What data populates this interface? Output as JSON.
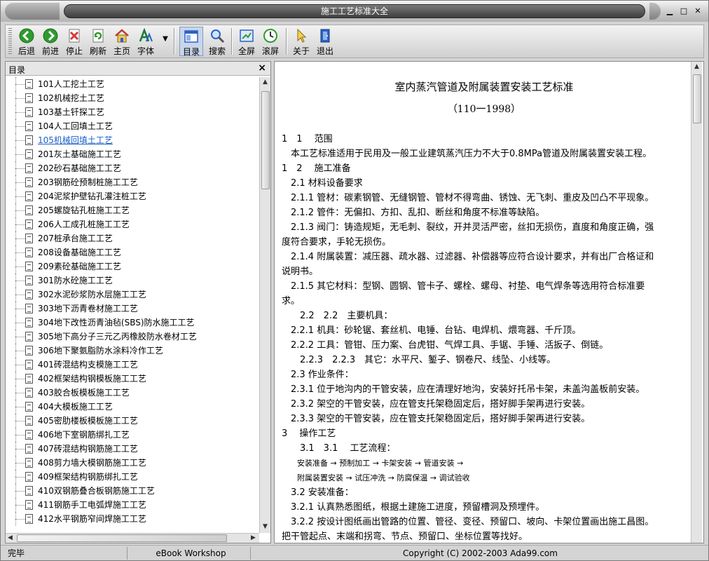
{
  "window": {
    "title": "施工工艺标准大全",
    "controls": {
      "minimize": "▁",
      "maximize": "□",
      "close": "✕"
    }
  },
  "toolbar": {
    "back": "后退",
    "forward": "前进",
    "stop": "停止",
    "refresh": "刷新",
    "home": "主页",
    "font": "字体",
    "contents": "目录",
    "search": "搜索",
    "fullscreen": "全屏",
    "scroll": "滚屏",
    "about": "关于",
    "exit": "退出",
    "colors": {
      "green": "#2e9b2e",
      "red": "#d23a3a",
      "blue": "#2a62c8"
    }
  },
  "sidebar": {
    "title": "目录",
    "close": "×",
    "items": [
      "101人工挖土工艺",
      "102机械挖土工艺",
      "103基土钎探工艺",
      "104人工回填土工艺",
      "105机械回填土工艺",
      "201灰土基础施工工艺",
      "202砂石基础施工工艺",
      "203钢筋砼预制桩施工工艺",
      "204泥浆护壁钻孔灌注桩工艺",
      "205螺旋钻孔桩施工工艺",
      "206人工成孔桩施工工艺",
      "207桩承台施工工艺",
      "208设备基础施工工艺",
      "209素砼基础施工工艺",
      "301防水砼施工工艺",
      "302水泥砂浆防水层施工工艺",
      "303地下沥青卷材施工工艺",
      "304地下改性沥青油毡(SBS)防水施工工艺",
      "305地下高分子三元乙丙橡胶防水卷材工艺",
      "306地下聚氨脂防水涂料冷作工艺",
      "401砖混结构支模施工工艺",
      "402框架结构钢模板施工工艺",
      "403胶合板模板施工工艺",
      "404大模板施工工艺",
      "405密肋楼板模板施工工艺",
      "406地下室钢筋绑扎工艺",
      "407砖混结构钢筋施工工艺",
      "408剪力墙大模钢筋施工工艺",
      "409框架结构钢筋绑扎工艺",
      "410双钢筋叠合板钢筋施工工艺",
      "411钢筋手工电弧焊施工工艺",
      "412水平钢筋窄间焊施工工艺"
    ],
    "selected_index": 4
  },
  "document": {
    "title": "室内蒸汽管道及附属装置安装工艺标准",
    "code": "（110一1998）",
    "lines": [
      "1　1　 范围",
      "　本工艺标准适用于民用及一般工业建筑蒸汽压力不大于0.8MPa管道及附属装置安装工程。",
      "1　2　 施工准备",
      "　2.1 材料设备要求",
      "　2.1.1 管材：碳素钢管、无缝钢管、管材不得弯曲、锈蚀、无飞刺、重皮及凹凸不平现象。",
      "　2.1.2 管件：无偏扣、方扣、乱扣、断丝和角度不标准等缺陷。",
      "　2.1.3 阀门：铸造规矩，无毛刺、裂纹，开并灵活严密，丝扣无损伤，直度和角度正确，强",
      "度符合要求，手轮无损伤。",
      "　2.1.4 附属装置：减压器、疏水器、过滤器、补偿器等应符合设计要求，并有出厂合格证和",
      "说明书。",
      "　2.1.5 其它材料：型钢、圆钢、管卡子、螺栓、螺母、衬垫、电气焊条等选用符合标准要",
      "求。",
      "　　2.2　2.2　主要机具：",
      "　2.2.1 机具：砂轮锯、套丝机、电锤、台钻、电焊机、煨弯器、千斤顶。",
      "　2.2.2 工具：管钳、压力案、台虎钳、气焊工具、手锯、手锤、活扳子、倒链。",
      "　　2.2.3　2.2.3　其它：水平尺、錾子、钢卷尺、线坠、小线等。",
      "　2.3 作业条件：",
      "　2.3.1 位于地沟内的干管安装，应在清理好地沟，安装好托吊卡架，未盖沟盖板前安装。",
      "　2.3.2 架空的干管安装，应在管支托架稳固定后，搭好脚手架再进行安装。",
      "　2.3.3 架空的干管安装，应在管支托架稳固定后，搭好脚手架再进行安装。",
      "3　 操作工艺",
      "　　3.1　3.1　 工艺流程：",
      "　　安装准备 → 预制加工 → 卡架安装 → 管道安装 →",
      "　　附属装置安装 → 试压冲洗 → 防腐保温 → 调试验收",
      "　3.2 安装准备：",
      "　3.2.1 认真熟悉图纸，根据土建施工进度，预留槽洞及预埋件。",
      "　3.2.2 按设计图纸画出管路的位置、管径、变径、预留口、坡向、卡架位置画出施工昌图。",
      "把干管起点、末端和拐弯、节点、预留口、坐标位置等找好。"
    ]
  },
  "status": {
    "left": "完毕",
    "middle": "eBook Workshop",
    "right": "Copyright (C) 2002-2003 Ada99.com"
  }
}
